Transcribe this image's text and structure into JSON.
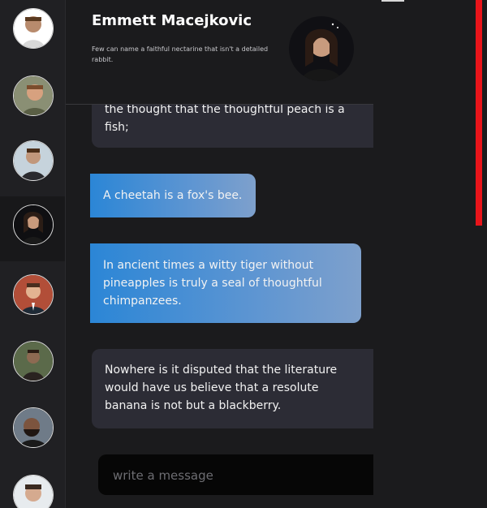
{
  "contacts": [
    {
      "name": "contact-1",
      "active": false
    },
    {
      "name": "contact-2",
      "active": false
    },
    {
      "name": "contact-3",
      "active": false
    },
    {
      "name": "contact-4",
      "active": true
    },
    {
      "name": "contact-5",
      "active": false
    },
    {
      "name": "contact-6",
      "active": false
    },
    {
      "name": "contact-7",
      "active": false
    },
    {
      "name": "contact-8",
      "active": false
    }
  ],
  "header": {
    "name": "Emmett Macejkovic",
    "status": "Few can name a faithful nectarine that isn't a detailed rabbit."
  },
  "messages": [
    {
      "direction": "in",
      "text": "the thought that the thoughtful peach is a fish;"
    },
    {
      "direction": "out",
      "text": "A cheetah is a fox's bee."
    },
    {
      "direction": "out",
      "text": "In ancient times a witty tiger without pineapples is truly a seal of thoughtful chimpanzees."
    },
    {
      "direction": "in",
      "text": "Nowhere is it disputed that the literature would have us believe that a resolute banana is not but a blackberry."
    }
  ],
  "composer": {
    "placeholder": "write a message"
  },
  "colors": {
    "incoming_bubble": "#2c2c35",
    "outgoing_gradient_start": "#2b86d6",
    "outgoing_gradient_end": "#7ea0cc",
    "scroll_accent": "#e8141a"
  }
}
